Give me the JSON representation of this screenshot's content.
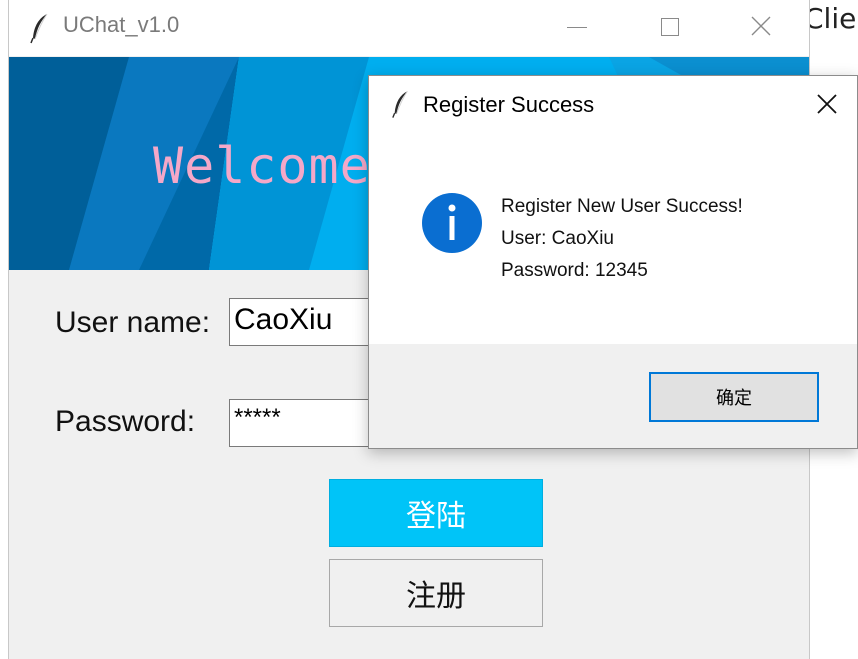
{
  "background": {
    "right_text": "Clier"
  },
  "main_window": {
    "title": "UChat_v1.0",
    "banner_text": "Welcome",
    "username_label": "User name:",
    "username_value": "CaoXiu",
    "password_label": "Password:",
    "password_value": "*****",
    "login_button": "登陆",
    "register_button": "注册",
    "icons": [
      "feather-icon",
      "minimize-icon",
      "maximize-icon",
      "close-icon"
    ],
    "colors": {
      "banner": "#00aeef",
      "login_button": "#00c4f8",
      "welcome_text": "#f4a8c8"
    }
  },
  "dialog": {
    "title": "Register Success",
    "message_lines": [
      "Register New User Success!",
      "User: CaoXiu",
      "Password: 12345"
    ],
    "ok_button": "确定",
    "icons": [
      "feather-icon",
      "info-icon",
      "close-icon"
    ],
    "colors": {
      "info_icon": "#0a6ed1",
      "button_border": "#0078d7"
    }
  }
}
